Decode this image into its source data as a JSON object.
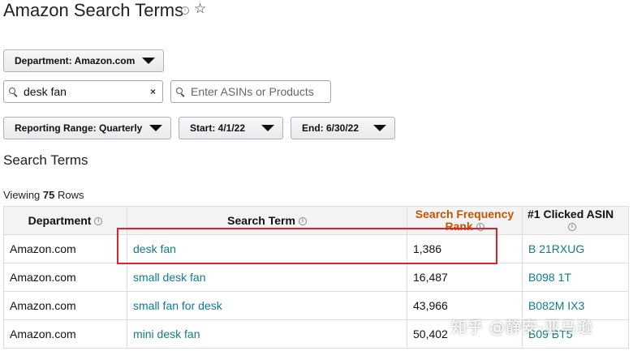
{
  "header": {
    "title": "Amazon Search Terms",
    "info_icon": "info-icon",
    "star_icon": "star-outline-icon",
    "star_glyph": "☆"
  },
  "filters": {
    "department": "Department: Amazon.com",
    "search_value": "desk fan",
    "clear_glyph": "×",
    "asin_placeholder": "Enter ASINs or Products",
    "reporting_range": "Reporting Range: Quarterly",
    "start": "Start: 4/1/22",
    "end": "End: 6/30/22"
  },
  "section": {
    "title": "Search Terms",
    "viewing_prefix": "Viewing",
    "row_count": "75",
    "viewing_suffix": "Rows"
  },
  "table": {
    "columns": [
      "Department",
      "Search Term",
      "Search Frequency Rank",
      "#1 Clicked ASIN"
    ],
    "rows": [
      {
        "department": "Amazon.com",
        "term": "desk fan",
        "rank": "1,386",
        "asin": "B     21RXUG"
      },
      {
        "department": "Amazon.com",
        "term": "small desk fan",
        "rank": "16,487",
        "asin": "B098     1T"
      },
      {
        "department": "Amazon.com",
        "term": "small fan for desk",
        "rank": "43,966",
        "asin": "B082M     IX3"
      },
      {
        "department": "Amazon.com",
        "term": "mini desk fan",
        "rank": "50,402",
        "asin": "B09     BT5"
      }
    ]
  },
  "colors": {
    "link": "#0f7c8c",
    "rank_header": "#c45500",
    "highlight": "#e0202a"
  },
  "watermark": "知乎 @静安-亚马逊"
}
